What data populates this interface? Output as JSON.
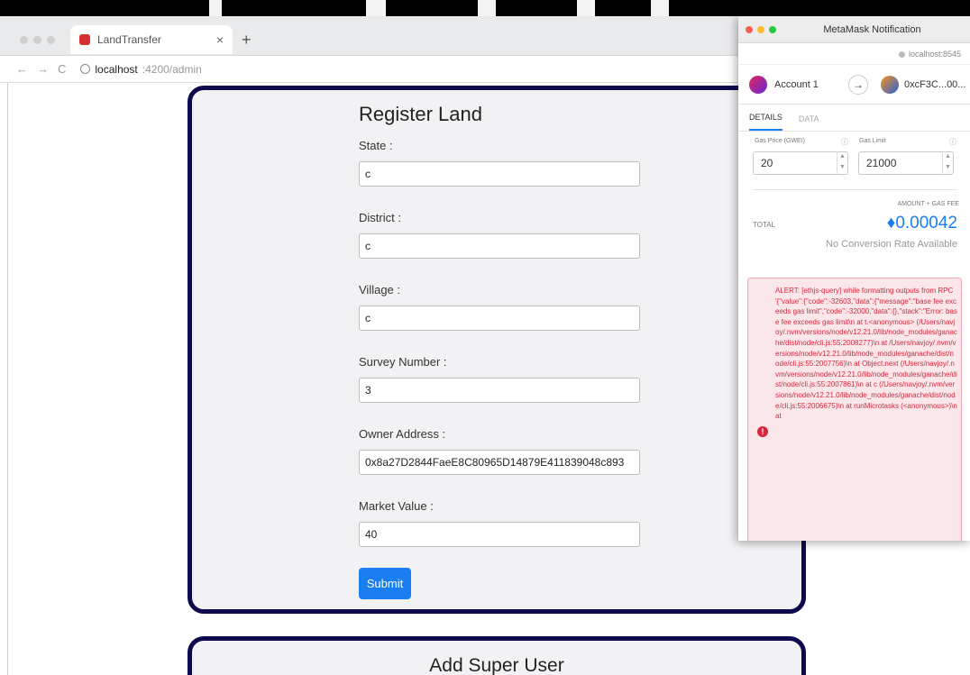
{
  "browser": {
    "tab_title": "LandTransfer",
    "tab_close": "×",
    "new_tab": "+",
    "nav_back": "←",
    "nav_forward": "→",
    "nav_reload": "C",
    "url_host": "localhost",
    "url_path": ":4200/admin"
  },
  "form": {
    "title": "Register Land",
    "fields": [
      {
        "label": "State :",
        "value": "c"
      },
      {
        "label": "District :",
        "value": "c"
      },
      {
        "label": "Village :",
        "value": "c"
      },
      {
        "label": "Survey Number :",
        "value": "3"
      },
      {
        "label": "Owner Address :",
        "value": "0x8a27D2844FaeE8C80965D14879E411839048c893"
      },
      {
        "label": "Market Value :",
        "value": "40"
      }
    ],
    "submit_label": "Submit"
  },
  "second_card": {
    "title": "Add Super User"
  },
  "metamask": {
    "window_title": "MetaMask Notification",
    "host": "localhost:8545",
    "from_account": "Account 1",
    "arrow": "→",
    "to_account": "0xcF3C...00...",
    "tabs": [
      "DETAILS",
      "DATA"
    ],
    "gas_price_label": "Gas Price (GWEI)",
    "gas_limit_label": "Gas Limit",
    "info_glyph": "ⓘ",
    "gas_price": "20",
    "gas_limit": "21000",
    "amount_gas_fee_label": "AMOUNT + GAS FEE",
    "total_label": "TOTAL",
    "total_value": "♦0.00042",
    "no_conversion": "No Conversion Rate Available",
    "alert_icon": "!",
    "alert_text": "ALERT: [ethjs-query] while formatting outputs from RPC '{\"value\":{\"code\":-32603,\"data\":{\"message\":\"base fee exceeds gas limit\",\"code\":-32000,\"data\":{},\"stack\":\"Error: base fee exceeds gas limit\\n at t.<anonymous> (/Users/navjoy/.nvm/versions/node/v12.21.0/lib/node_modules/ganache/dist/node/cli.js:55:2008277)\\n at /Users/navjoy/.nvm/versions/node/v12.21.0/lib/node_modules/ganache/dist/node/cli.js:55:2007756)\\n at Object.next (/Users/navjoy/.nvm/versions/node/v12.21.0/lib/node_modules/ganache/dist/node/cli.js:55:2007861)\\n at c (/Users/navjoy/.nvm/versions/node/v12.21.0/lib/node_modules/ganache/dist/node/cli.js:55:2006675)\\n at runMicrotasks (<anonymous>)\\n at"
  }
}
